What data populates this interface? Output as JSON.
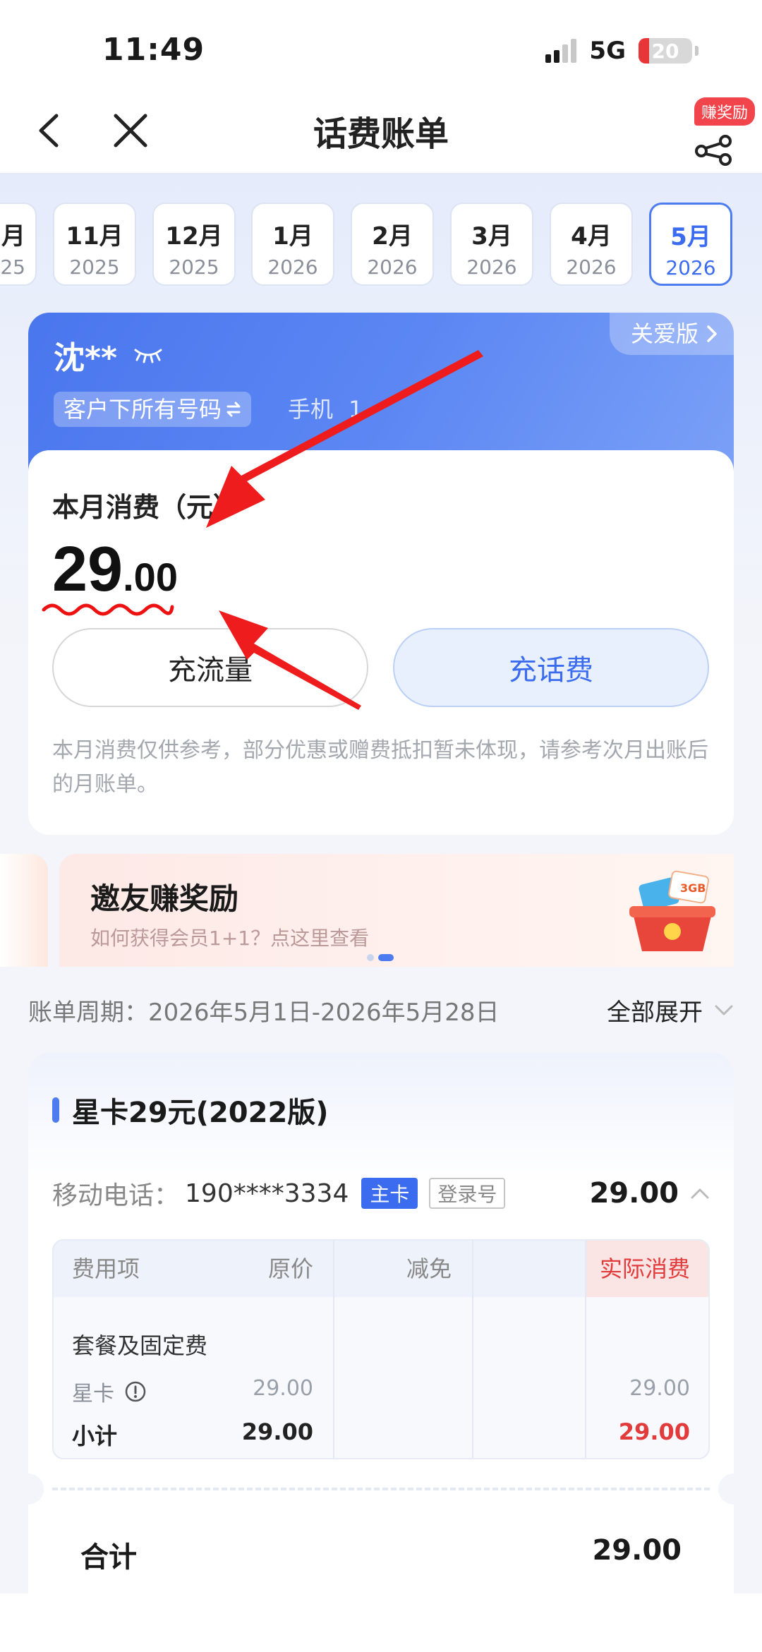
{
  "status": {
    "time": "11:49",
    "network": "5G",
    "battery": "20",
    "battery_level": 0.2
  },
  "nav": {
    "title": "话费账单",
    "share_badge": "赚奖励"
  },
  "months": [
    {
      "m": "月",
      "y": "25"
    },
    {
      "m": "11月",
      "y": "2025"
    },
    {
      "m": "12月",
      "y": "2025"
    },
    {
      "m": "1月",
      "y": "2026"
    },
    {
      "m": "2月",
      "y": "2026"
    },
    {
      "m": "3月",
      "y": "2026"
    },
    {
      "m": "4月",
      "y": "2026"
    },
    {
      "m": "5月",
      "y": "2026",
      "active": true
    }
  ],
  "user": {
    "name": "沈**",
    "care_version": "关爱版",
    "number_scope": "客户下所有号码",
    "phone_label": "手机",
    "phone_count": "1"
  },
  "bill": {
    "label": "本月消费（元）",
    "amount_int": "29",
    "amount_dec": ".00",
    "btn_flow": "充流量",
    "btn_topup": "充话费",
    "note": "本月消费仅供参考，部分优惠或赠费抵扣暂未体现，请参考次月出账后的月账单。"
  },
  "promo": {
    "title": "邀友赚奖励",
    "subtitle": "如何获得会员1+1？点这里查看",
    "gift_badge": "3GB"
  },
  "period": {
    "text": "账单周期：2026年5月1日-2026年5月28日",
    "expand": "全部展开"
  },
  "plan": {
    "title": "星卡29元(2022版)",
    "line_label": "移动电话：",
    "line_number": "190****3334",
    "tag_main": "主卡",
    "tag_login": "登录号",
    "line_total": "29.00",
    "table": {
      "headers": [
        "费用项",
        "原价",
        "减免",
        "实际消费"
      ],
      "group": "套餐及固定费",
      "item": {
        "name": "星卡",
        "original": "29.00",
        "discount": "",
        "actual": "29.00"
      },
      "subtotal": {
        "name": "小计",
        "original": "29.00",
        "discount": "",
        "actual": "29.00"
      }
    },
    "sum_label": "合计",
    "sum_value": "29.00"
  },
  "colors": {
    "accent": "#3b6cf0",
    "red": "#e23b3b",
    "annotation": "#ee1c1c"
  }
}
